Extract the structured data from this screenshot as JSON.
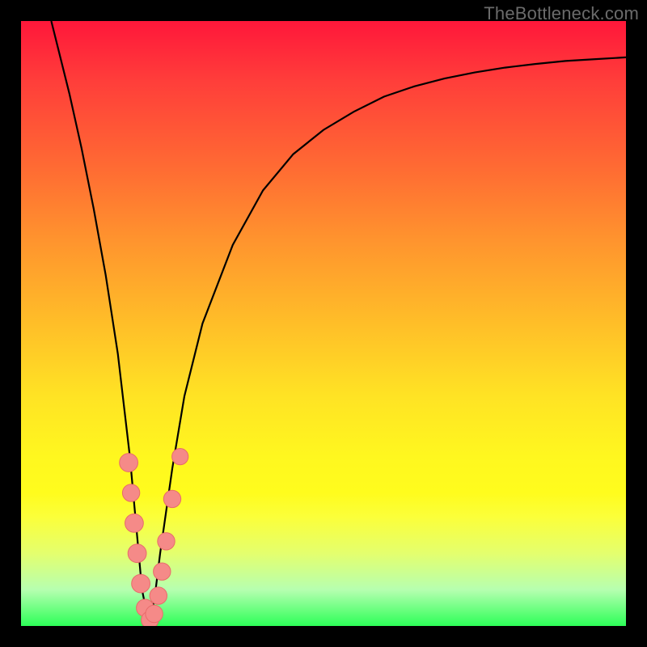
{
  "watermark": "TheBottleneck.com",
  "colors": {
    "frame": "#000000",
    "curve": "#000000",
    "marker_fill": "#f58a88",
    "marker_stroke": "#e86b6a",
    "gradient_top": "#ff173a",
    "gradient_bottom": "#2dff58"
  },
  "chart_data": {
    "type": "line",
    "title": "",
    "xlabel": "",
    "ylabel": "",
    "xlim": [
      0,
      100
    ],
    "ylim": [
      0,
      100
    ],
    "grid": false,
    "legend": false,
    "series": [
      {
        "name": "bottleneck-curve",
        "x": [
          5,
          8,
          10,
          12,
          14,
          16,
          18,
          19,
          20,
          21,
          22,
          23,
          25,
          27,
          30,
          35,
          40,
          45,
          50,
          55,
          60,
          65,
          70,
          75,
          80,
          85,
          90,
          95,
          100
        ],
        "values": [
          100,
          88,
          79,
          69,
          58,
          45,
          28,
          17,
          6,
          1,
          4,
          12,
          26,
          38,
          50,
          63,
          72,
          78,
          82,
          85,
          87.5,
          89.2,
          90.5,
          91.5,
          92.3,
          92.9,
          93.4,
          93.7,
          94
        ]
      }
    ],
    "markers": [
      {
        "x": 17.8,
        "y": 27,
        "r": 1.1
      },
      {
        "x": 18.2,
        "y": 22,
        "r": 1.0
      },
      {
        "x": 18.7,
        "y": 17,
        "r": 1.1
      },
      {
        "x": 19.2,
        "y": 12,
        "r": 1.1
      },
      {
        "x": 19.8,
        "y": 7,
        "r": 1.1
      },
      {
        "x": 20.5,
        "y": 3,
        "r": 1.0
      },
      {
        "x": 21.3,
        "y": 1,
        "r": 1.0
      },
      {
        "x": 22.0,
        "y": 2,
        "r": 1.0
      },
      {
        "x": 22.7,
        "y": 5,
        "r": 1.0
      },
      {
        "x": 23.3,
        "y": 9,
        "r": 1.0
      },
      {
        "x": 24.0,
        "y": 14,
        "r": 1.0
      },
      {
        "x": 25.0,
        "y": 21,
        "r": 1.0
      },
      {
        "x": 26.3,
        "y": 28,
        "r": 0.9
      }
    ]
  }
}
